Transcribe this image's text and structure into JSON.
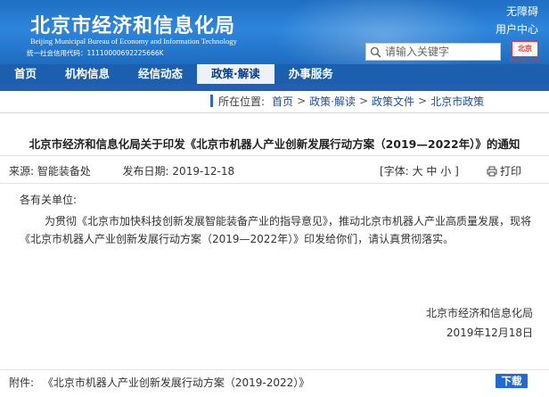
{
  "header": {
    "title_cn": "北京市经济和信息化局",
    "title_en": "Beijing Municipal Bureau of Economy and Information Technology",
    "credit_code": "统一社会信用代码：11110000692225666K",
    "links": [
      "无障碍",
      "用户中心"
    ],
    "search_placeholder": "请输入关键字",
    "badge_text": "北京",
    "badge_sub": "Beijing China"
  },
  "nav": {
    "items": [
      "首页",
      "机构信息",
      "经信动态",
      "政策·解读",
      "办事服务"
    ],
    "active_index": 3
  },
  "breadcrumb": {
    "label": "所在位置:",
    "items": [
      "首页",
      "政策·解读",
      "政策文件",
      "北京市政策"
    ],
    "separator": ">"
  },
  "article": {
    "title": "北京市经济和信息化局关于印发《北京市机器人产业创新发展行动方案（2019—2022年）》的通知",
    "source_label": "来源:",
    "source": "智能装备处",
    "date_label": "发布日期:",
    "date": "2019-12-18",
    "font_label": "[字体:",
    "font_sizes": [
      "大",
      "中",
      "小"
    ],
    "font_close": "]",
    "print_label": "打印",
    "salutation": "各有关单位:",
    "paragraph": "为贯彻《北京市加快科技创新发展智能装备产业的指导意见》，推动北京市机器人产业高质量发展，现将《北京市机器人产业创新发展行动方案（2019—2022年）》印发给你们，请认真贯彻落实。",
    "signature_org": "北京市经济和信息化局",
    "signature_date": "2019年12月18日",
    "attachment_label": "附件:",
    "attachment_name": "《北京市机器人产业创新发展行动方案（2019-2022）》",
    "download_label": "下载"
  },
  "colors": {
    "header_blue": "#2e86dc",
    "nav_blue": "#1c5fae",
    "active_tab_bg": "#eef2f7",
    "link_blue": "#1f4f96",
    "download_bg": "#1f6bd1",
    "stamp_red": "#e63b2e"
  }
}
